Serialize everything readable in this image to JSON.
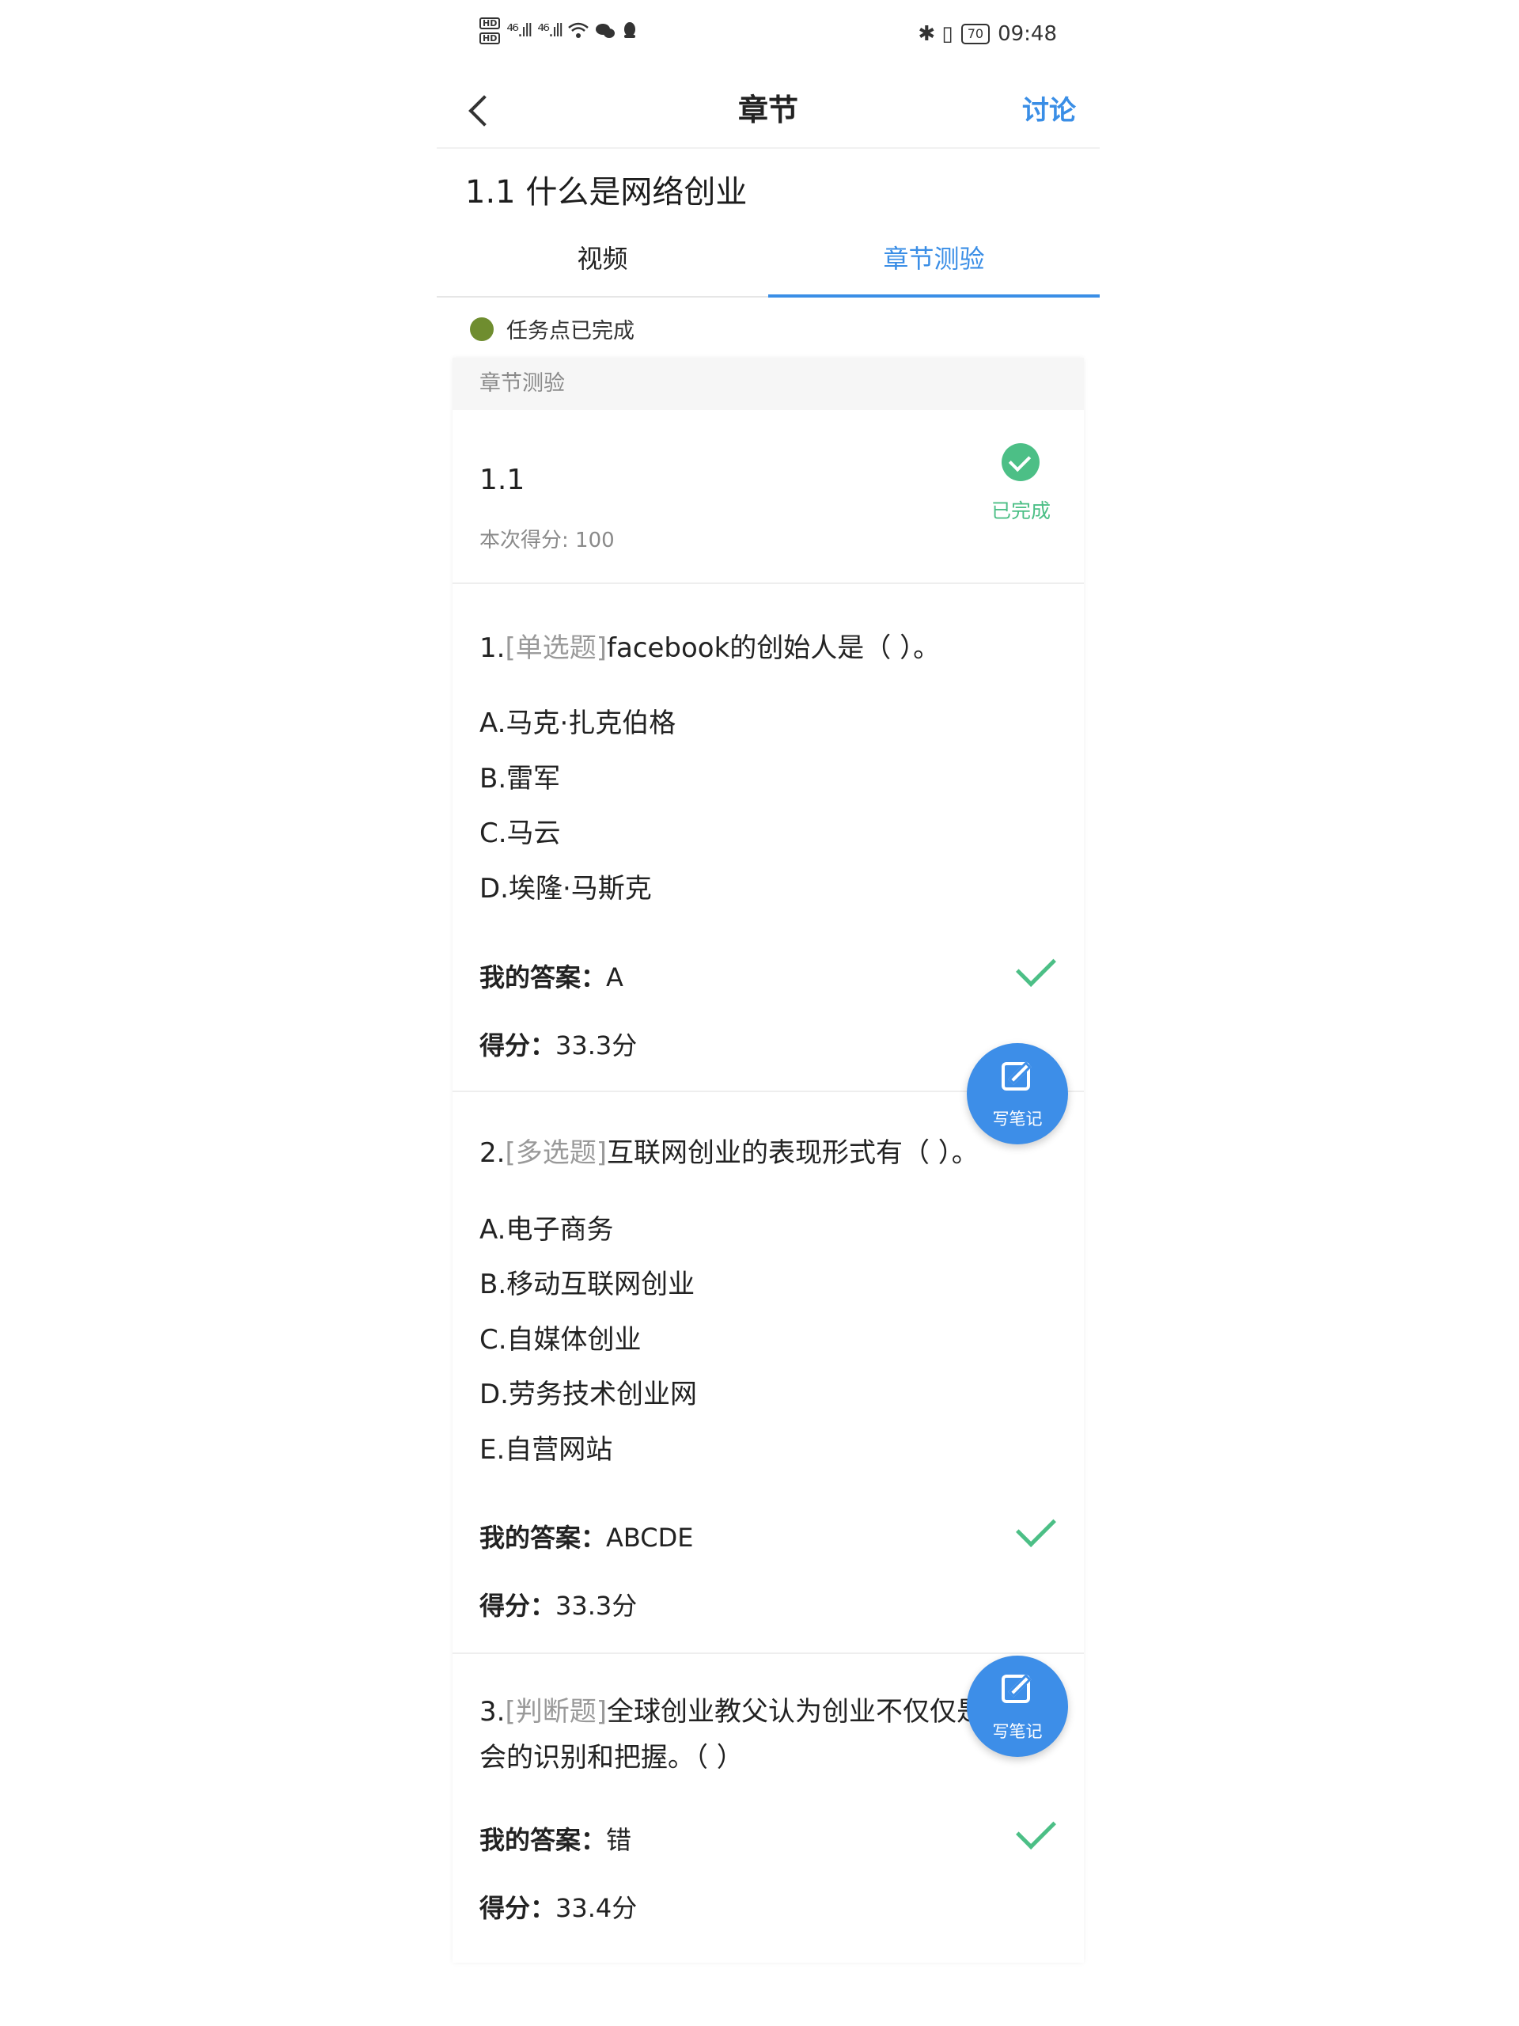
{
  "status_bar": {
    "hd1": "HD",
    "hd2": "HD",
    "signal1": "⁴⁶.ıll",
    "signal2": "⁴⁶.ıll",
    "right_icons": "✱ ▯",
    "battery": "70",
    "time": "09:48"
  },
  "header": {
    "title": "章节",
    "discuss": "讨论"
  },
  "chapter_title": "1.1 什么是网络创业",
  "tabs": {
    "video": "视频",
    "quiz": "章节测验"
  },
  "task_status": "任务点已完成",
  "card": {
    "head": "章节测验",
    "result_title": "1.1",
    "result_score": "本次得分: 100",
    "done_label": "已完成"
  },
  "questions": [
    {
      "num": "1.",
      "type": "[单选题]",
      "text": "facebook的创始人是（ ）。",
      "options": [
        "A.马克·扎克伯格",
        "B.雷军",
        "C.马云",
        "D.埃隆·马斯克"
      ],
      "answer_label": "我的答案：",
      "answer": "A",
      "score_label": "得分：",
      "score": "33.3分"
    },
    {
      "num": "2.",
      "type": "[多选题]",
      "text": "互联网创业的表现形式有（ ）。",
      "options": [
        "A.电子商务",
        "B.移动互联网创业",
        "C.自媒体创业",
        "D.劳务技术创业网",
        "E.自营网站"
      ],
      "answer_label": "我的答案：",
      "answer": "ABCDE",
      "score_label": "得分：",
      "score": "33.3分"
    },
    {
      "num": "3.",
      "type": "[判断题]",
      "text_line1": "全球创业教父认为创业不仅仅是",
      "text_line2": "会的识别和把握。（ ）",
      "answer_label": "我的答案：",
      "answer": "错",
      "score_label": "得分：",
      "score": "33.4分"
    }
  ],
  "note_button_label": "写笔记"
}
